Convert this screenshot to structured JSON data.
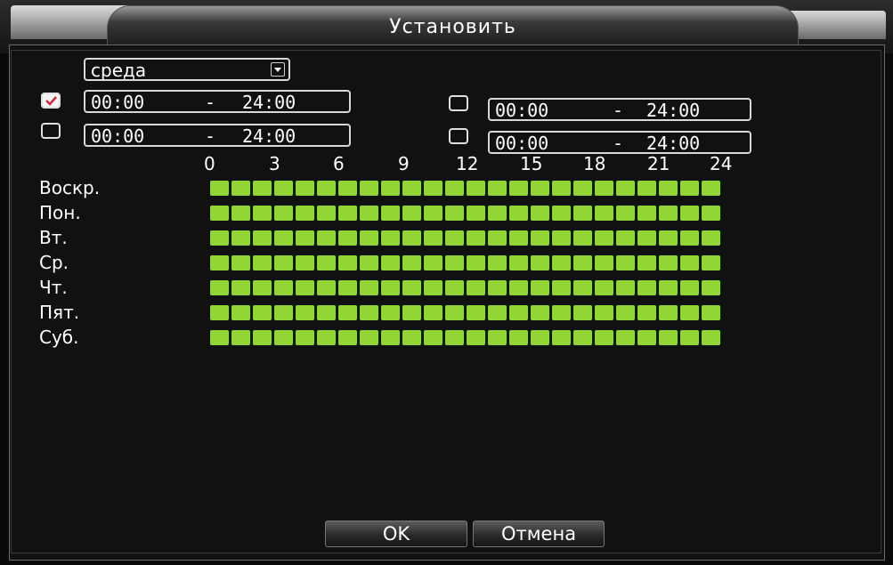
{
  "dialog": {
    "title": "Установить"
  },
  "day_select": {
    "value": "среда"
  },
  "periods": [
    {
      "checked": true,
      "start": "00:00",
      "dash": "-",
      "end": "24:00"
    },
    {
      "checked": false,
      "start": "00:00",
      "dash": "-",
      "end": "24:00"
    },
    {
      "checked": false,
      "start": "00:00",
      "dash": "-",
      "end": "24:00"
    },
    {
      "checked": false,
      "start": "00:00",
      "dash": "-",
      "end": "24:00"
    }
  ],
  "hour_labels": [
    "0",
    "3",
    "6",
    "9",
    "12",
    "15",
    "18",
    "21",
    "24"
  ],
  "days": [
    "Воскр.",
    "Пон.",
    "Вт.",
    "Ср.",
    "Чт.",
    "Пят.",
    "Суб."
  ],
  "schedule": {
    "hours_per_day": 24,
    "all_hours_active": true,
    "active_color": "#92d636"
  },
  "buttons": {
    "ok": "OK",
    "cancel": "Отмена"
  }
}
